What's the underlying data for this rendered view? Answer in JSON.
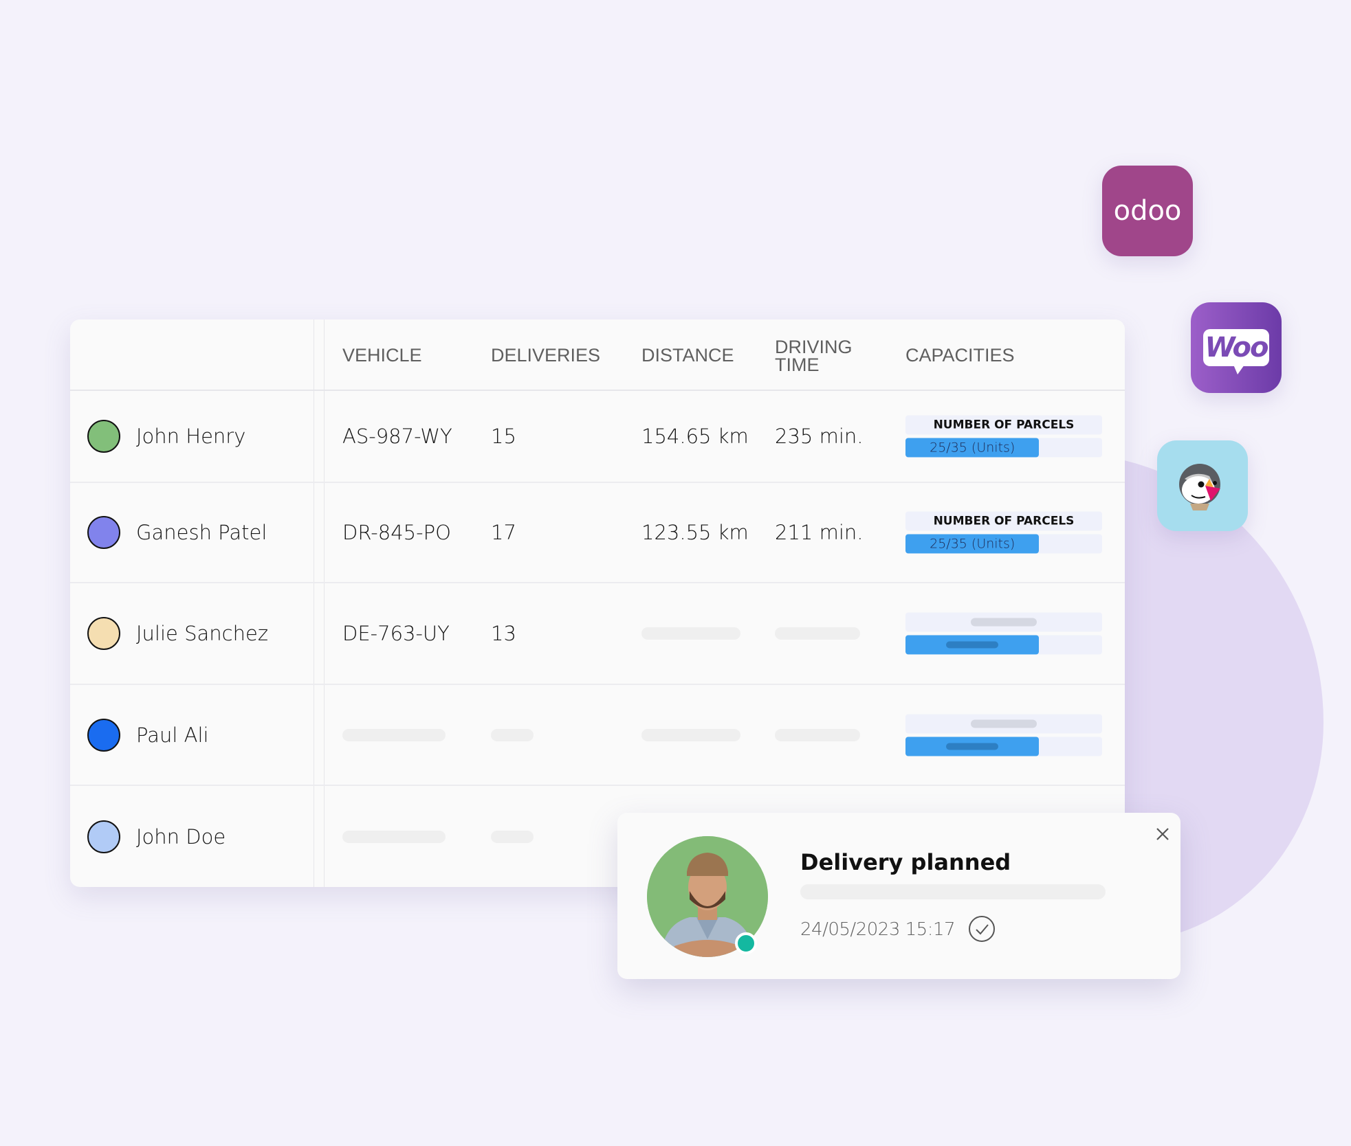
{
  "integrations": [
    {
      "name": "odoo",
      "label": "odoo",
      "color": "#a0468a"
    },
    {
      "name": "woocommerce",
      "label": "Woo",
      "color": "#7b4bb5"
    },
    {
      "name": "prestashop",
      "label": "",
      "color": "#a6ddee"
    }
  ],
  "table": {
    "headers": {
      "vehicle": "VEHICLE",
      "deliveries": "DELIVERIES",
      "distance": "DISTANCE",
      "driving_time_line1": "DRIVING",
      "driving_time_line2": "TIME",
      "capacities": "CAPACITIES"
    },
    "rows": [
      {
        "name": "John Henry",
        "color": "#82bf7a",
        "vehicle": "AS-987-WY",
        "deliveries": "15",
        "distance": "154.65 km",
        "driving_time": "235 min.",
        "capacity_label": "NUMBER OF PARCELS",
        "capacity_value": "25/35 (Units)",
        "capacity_fraction": 0.68
      },
      {
        "name": "Ganesh Patel",
        "color": "#8183ec",
        "vehicle": "DR-845-PO",
        "deliveries": "17",
        "distance": "123.55 km",
        "driving_time": "211 min.",
        "capacity_label": "NUMBER OF PARCELS",
        "capacity_value": "25/35 (Units)",
        "capacity_fraction": 0.68
      },
      {
        "name": "Julie Sanchez",
        "color": "#f5deb1",
        "vehicle": "DE-763-UY",
        "deliveries": "13",
        "distance": null,
        "driving_time": null,
        "capacity_label": null,
        "capacity_value": null,
        "capacity_fraction": 0.68
      },
      {
        "name": "Paul Ali",
        "color": "#1a6cf0",
        "vehicle": null,
        "deliveries": null,
        "distance": null,
        "driving_time": null,
        "capacity_label": null,
        "capacity_value": null,
        "capacity_fraction": 0.68
      },
      {
        "name": "John Doe",
        "color": "#b1cbf6",
        "vehicle": null,
        "deliveries": null,
        "distance": null,
        "driving_time": null,
        "capacity_label": null,
        "capacity_value": null,
        "capacity_fraction": null
      }
    ]
  },
  "notification": {
    "title": "Delivery planned",
    "timestamp": "24/05/2023 15:17",
    "status_color": "#14b8a0",
    "avatar_bg": "#83bb77"
  },
  "colors": {
    "background": "#f4f2fb",
    "blob": "#e2d9f3",
    "capacity_fill": "#3ea0ef",
    "capacity_track": "#eff1fb"
  }
}
